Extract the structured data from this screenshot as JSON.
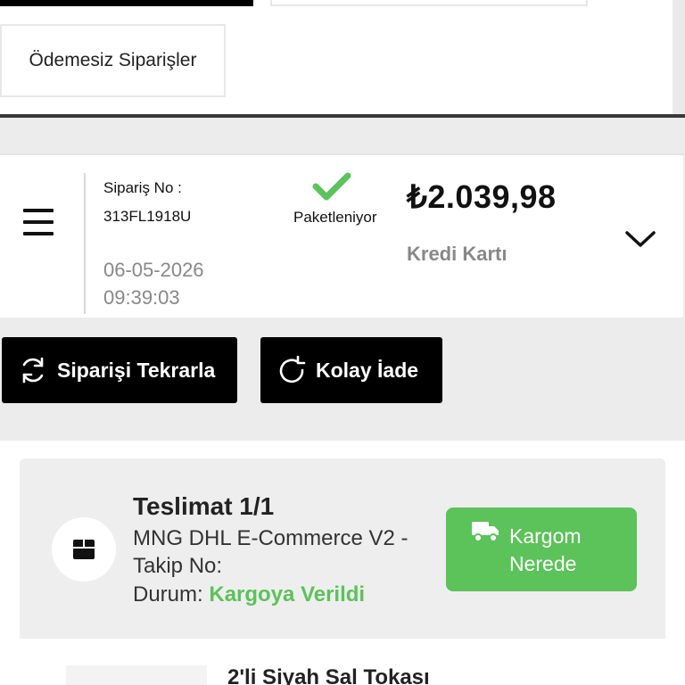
{
  "tabs": {
    "unpaid_orders": "Ödemesiz Siparişler"
  },
  "order": {
    "no_label": "Sipariş No :",
    "no_value": "313FL1918U",
    "date": "06-05-2026",
    "time": "09:39:03",
    "status": "Paketleniyor",
    "price": "₺2.039,98",
    "payment_method": "Kredi Kartı"
  },
  "actions": {
    "repeat_order": "Siparişi Tekrarla",
    "easy_return": "Kolay İade"
  },
  "shipment": {
    "title": "Teslimat 1/1",
    "carrier": "MNG DHL E-Commerce V2 -",
    "tracking_label": "Takip No:",
    "status_label": "Durum:",
    "status_value": "Kargoya Verildi",
    "track_button_line1": "Kargom",
    "track_button_line2": "Nerede"
  },
  "product": {
    "name": "2'li Siyah Sal Tokası"
  },
  "icons": {
    "menu": "hamburger-icon",
    "status": "check-icon",
    "expand": "chevron-down-icon",
    "repeat": "refresh-icon",
    "return": "rotate-icon",
    "package": "box-icon",
    "truck": "truck-icon"
  },
  "colors": {
    "accent_green": "#5cc25a",
    "button_black": "#000000",
    "muted_text": "#888888"
  }
}
